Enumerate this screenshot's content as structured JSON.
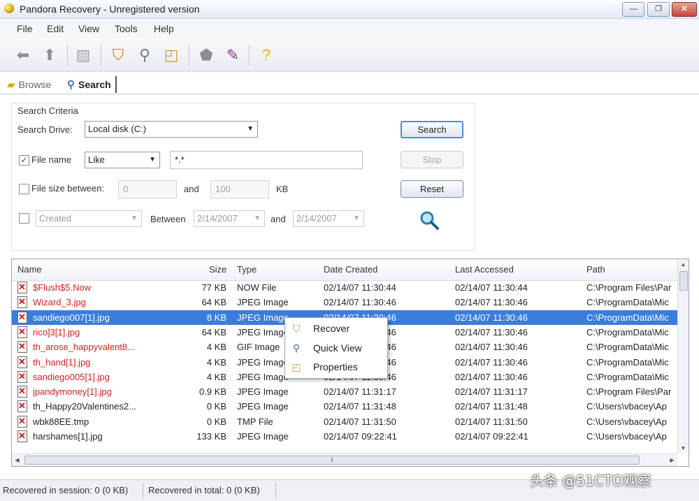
{
  "window": {
    "title": "Pandora Recovery - Unregistered version"
  },
  "menu": [
    "File",
    "Edit",
    "View",
    "Tools",
    "Help"
  ],
  "tabs": {
    "browse": "Browse",
    "search": "Search"
  },
  "criteria": {
    "group_label": "Search Criteria",
    "drive_label": "Search Drive:",
    "drive_value": "Local disk (C:)",
    "filename_label": "File name",
    "filename_checked": true,
    "match_value": "Like",
    "pattern_value": "*.*",
    "filesize_label": "File size between:",
    "size_from": "0",
    "and_label": "and",
    "size_to": "100",
    "kb_label": "KB",
    "date_type_value": "Created",
    "between_label": "Between",
    "date_from": "2/14/2007",
    "date_to": "2/14/2007"
  },
  "buttons": {
    "search": "Search",
    "stop": "Stop",
    "reset": "Reset"
  },
  "grid": {
    "columns": [
      "Name",
      "Size",
      "Type",
      "Date Created",
      "Last Accessed",
      "Path"
    ],
    "rows": [
      {
        "name": "$Flush$5.Now",
        "size": "77 KB",
        "type": "NOW File",
        "created": "02/14/07 11:30:44",
        "accessed": "02/14/07 11:30:44",
        "path": "C:\\Program Files\\Par",
        "red": true,
        "selected": false
      },
      {
        "name": "Wizard_3.jpg",
        "size": "64 KB",
        "type": "JPEG Image",
        "created": "02/14/07 11:30:46",
        "accessed": "02/14/07 11:30:46",
        "path": "C:\\ProgramData\\Mic",
        "red": true,
        "selected": false
      },
      {
        "name": "sandiego007[1].jpg",
        "size": "8 KB",
        "type": "JPEG Image",
        "created": "02/14/07 11:30:46",
        "accessed": "02/14/07 11:30:46",
        "path": "C:\\ProgramData\\Mic",
        "red": true,
        "selected": true
      },
      {
        "name": "rico]3[1].jpg",
        "size": "64 KB",
        "type": "JPEG Image",
        "created": "02/14/07 11:30:46",
        "accessed": "02/14/07 11:30:46",
        "path": "C:\\ProgramData\\Mic",
        "red": true,
        "selected": false
      },
      {
        "name": "th_arose_happyvalent8...",
        "size": "4 KB",
        "type": "GIF Image",
        "created": "02/14/07 11:30:46",
        "accessed": "02/14/07 11:30:46",
        "path": "C:\\ProgramData\\Mic",
        "red": true,
        "selected": false
      },
      {
        "name": "th_hand[1].jpg",
        "size": "4 KB",
        "type": "JPEG Image",
        "created": "02/14/07 11:30:46",
        "accessed": "02/14/07 11:30:46",
        "path": "C:\\ProgramData\\Mic",
        "red": true,
        "selected": false
      },
      {
        "name": "sandiego005[1].jpg",
        "size": "4 KB",
        "type": "JPEG Image",
        "created": "02/14/07 11:30:46",
        "accessed": "02/14/07 11:30:46",
        "path": "C:\\ProgramData\\Mic",
        "red": true,
        "selected": false
      },
      {
        "name": "jpandymoney[1].jpg",
        "size": "0.9 KB",
        "type": "JPEG Image",
        "created": "02/14/07 11:31:17",
        "accessed": "02/14/07 11:31:17",
        "path": "C:\\Program Files\\Par",
        "red": true,
        "selected": false
      },
      {
        "name": "th_Happy20Valentines2...",
        "size": "0 KB",
        "type": "JPEG Image",
        "created": "02/14/07 11:31:48",
        "accessed": "02/14/07 11:31:48",
        "path": "C:\\Users\\vbacey\\Ap",
        "red": false,
        "selected": false
      },
      {
        "name": "wbk88EE.tmp",
        "size": "0 KB",
        "type": "TMP File",
        "created": "02/14/07 11:31:50",
        "accessed": "02/14/07 11:31:50",
        "path": "C:\\Users\\vbacey\\Ap",
        "red": false,
        "selected": false
      },
      {
        "name": "harshames[1].jpg",
        "size": "133 KB",
        "type": "JPEG Image",
        "created": "02/14/07 09:22:41",
        "accessed": "02/14/07 09:22:41",
        "path": "C:\\Users\\vbacey\\Ap",
        "red": false,
        "selected": false
      }
    ]
  },
  "context_menu": {
    "items": [
      {
        "label": "Recover",
        "icon": "recover-icon"
      },
      {
        "label": "Quick View",
        "icon": "magnifier-icon"
      },
      {
        "label": "Properties",
        "icon": "properties-icon"
      }
    ]
  },
  "status": {
    "session": "Recovered in session: 0 (0 KB)",
    "total": "Recovered in total: 0 (0 KB)"
  },
  "watermark": "头条 @51CTO观察"
}
